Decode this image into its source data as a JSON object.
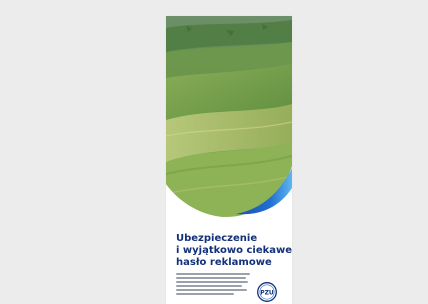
{
  "banner": {
    "headline_bold": "Ubezpieczenie",
    "headline_line2": "i wyjątkowo ciekawe",
    "headline_line3": "hasło reklamowe",
    "logo_text": "PZU"
  },
  "colors": {
    "background": "#ececec",
    "brand_navy": "#13307a",
    "brand_blue": "#1f6fd1",
    "brand_light": "#5fb6f0"
  },
  "icons": {
    "logo": "pzu-logo-icon"
  }
}
